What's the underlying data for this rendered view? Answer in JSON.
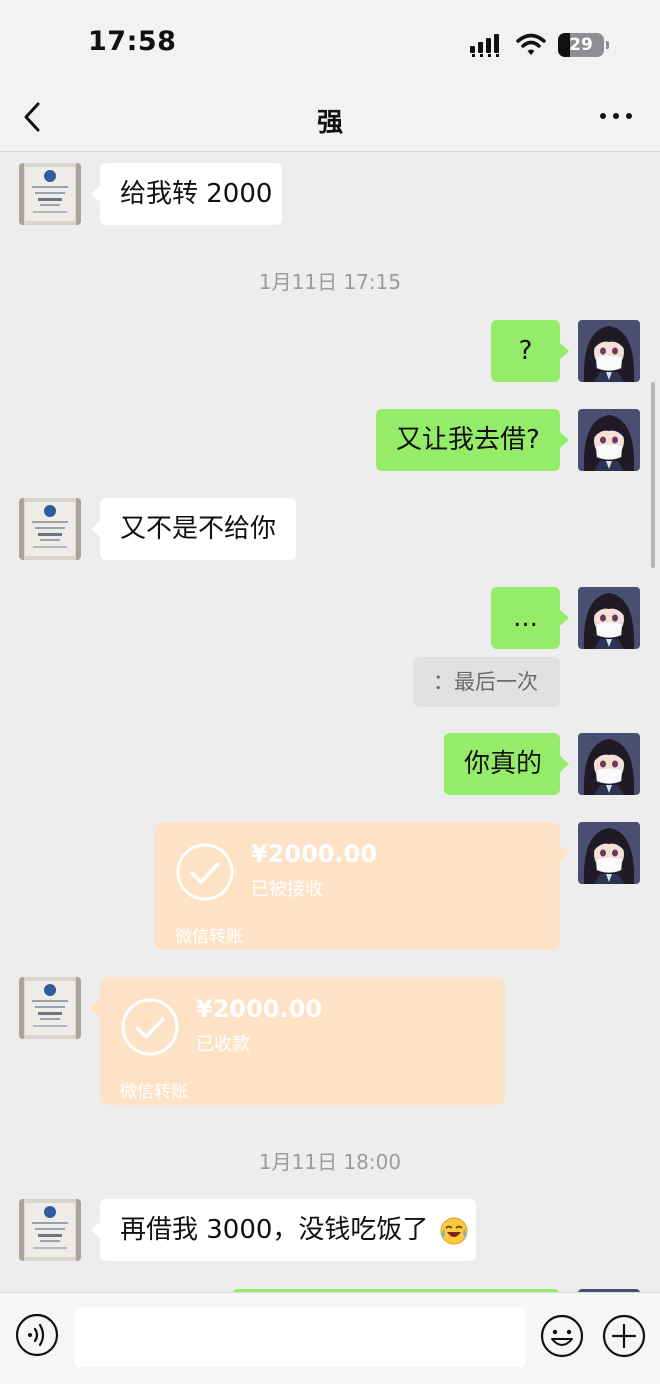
{
  "status_bar": {
    "time": "17:58",
    "battery": "29",
    "icons": [
      "signal-icon",
      "wifi-icon",
      "battery-icon"
    ]
  },
  "nav": {
    "back_icon": "chevron-left-icon",
    "title": "强",
    "more_icon": "more-icon"
  },
  "messages": [
    {
      "side": "left",
      "type": "text",
      "text": "给我转 2000"
    },
    {
      "type": "timestamp",
      "text": "1月11日 17:15"
    },
    {
      "side": "right",
      "type": "text",
      "text": "?"
    },
    {
      "side": "right",
      "type": "text",
      "text": "又让我去借?"
    },
    {
      "side": "left",
      "type": "text",
      "text": "又不是不给你"
    },
    {
      "side": "right",
      "type": "text",
      "text": "..."
    },
    {
      "type": "quote",
      "text": "：最后一次"
    },
    {
      "side": "right",
      "type": "text",
      "text": "你真的"
    },
    {
      "side": "right",
      "type": "transfer",
      "amount": "¥2000.00",
      "status": "已被接收",
      "footer": "微信转账"
    },
    {
      "side": "left",
      "type": "transfer",
      "amount": "¥2000.00",
      "status": "已收款",
      "footer": "微信转账"
    },
    {
      "type": "timestamp",
      "text": "1月11日 18:00"
    },
    {
      "side": "left",
      "type": "text",
      "text": "再借我 3000，没钱吃饭了",
      "emoji": "laughing-crying-emoji"
    }
  ],
  "input_bar": {
    "voice_icon": "voice-icon",
    "input_value": "",
    "emoji_icon": "emoji-icon",
    "plus_icon": "plus-icon"
  },
  "colors": {
    "green_bubble": "#95ec69",
    "white_bubble": "#ffffff",
    "transfer_bg": "#fde2c5",
    "background": "#ededed"
  }
}
